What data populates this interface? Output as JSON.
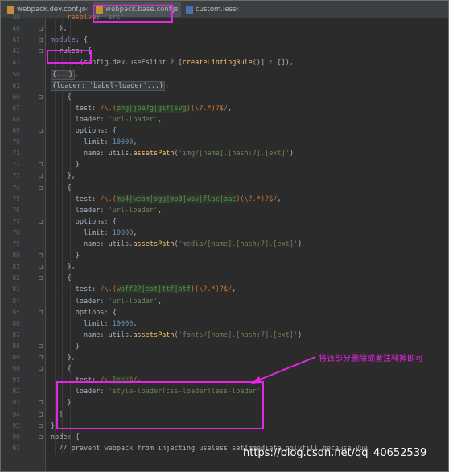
{
  "tabs": [
    {
      "label": "webpack.dev.conf.js",
      "close": "×",
      "icon": "js-file-icon",
      "active": false
    },
    {
      "label": "webpack.base.conf.js",
      "close": "×",
      "icon": "js-file-icon",
      "active": true
    },
    {
      "label": "custom.less",
      "close": "×",
      "icon": "less-file-icon",
      "active": false
    }
  ],
  "lines": [
    {
      "n": "39",
      "segs": [
        [
          "",
          "    "
        ],
        [
          "k",
          "resolve"
        ],
        [
          "",
          ": "
        ],
        [
          "s",
          "'src'"
        ],
        [
          "",
          ""
        ]
      ],
      "partial": true
    },
    {
      "n": "40",
      "segs": [
        [
          "",
          "  },"
        ]
      ]
    },
    {
      "n": "41",
      "segs": [
        [
          "p",
          "module"
        ],
        [
          "",
          ": {"
        ]
      ]
    },
    {
      "n": "42",
      "segs": [
        [
          "",
          "  rules: ["
        ]
      ]
    },
    {
      "n": "43",
      "segs": [
        [
          "",
          "    ..."
        ],
        [
          "",
          "(config.dev."
        ],
        [
          "",
          "useEslint"
        ],
        [
          "",
          " ? ["
        ],
        [
          "f",
          "createLintingRule"
        ],
        [
          "",
          "()] : []),"
        ]
      ]
    },
    {
      "n": "50",
      "segs": [
        [
          "fd",
          "{...}"
        ],
        [
          "",
          ","
        ]
      ]
    },
    {
      "n": "61",
      "segs": [
        [
          "fd",
          "{loader: 'babel-loader'...}"
        ],
        [
          "",
          ","
        ]
      ]
    },
    {
      "n": "66",
      "segs": [
        [
          "",
          "    {"
        ]
      ]
    },
    {
      "n": "67",
      "segs": [
        [
          "",
          "      test: "
        ],
        [
          "rxm",
          "/\\.("
        ],
        [
          "rx",
          "png|jpe?g|gif|svg"
        ],
        [
          "rxm",
          ")(\\?.*)?$/"
        ],
        [
          "",
          ","
        ]
      ]
    },
    {
      "n": "68",
      "segs": [
        [
          "",
          "      loader: "
        ],
        [
          "s",
          "'url-loader'"
        ],
        [
          "",
          ","
        ]
      ]
    },
    {
      "n": "69",
      "segs": [
        [
          "",
          "      options: {"
        ]
      ]
    },
    {
      "n": "70",
      "segs": [
        [
          "",
          "        limit: "
        ],
        [
          "n",
          "10000"
        ],
        [
          "",
          ","
        ]
      ]
    },
    {
      "n": "71",
      "segs": [
        [
          "",
          "        name: utils."
        ],
        [
          "f",
          "assetsPath"
        ],
        [
          "",
          "("
        ],
        [
          "s",
          "'img/[name].[hash:7].[ext]'"
        ],
        [
          "",
          ")"
        ]
      ]
    },
    {
      "n": "72",
      "segs": [
        [
          "",
          "      }"
        ]
      ]
    },
    {
      "n": "73",
      "segs": [
        [
          "",
          "    },"
        ]
      ]
    },
    {
      "n": "74",
      "segs": [
        [
          "",
          "    {"
        ]
      ]
    },
    {
      "n": "75",
      "segs": [
        [
          "",
          "      test: "
        ],
        [
          "rxm",
          "/\\.("
        ],
        [
          "rx",
          "mp4|webm|ogg|mp3|wav|flac|aac"
        ],
        [
          "rxm",
          ")(\\?.*)?$/"
        ],
        [
          "",
          ","
        ]
      ]
    },
    {
      "n": "76",
      "segs": [
        [
          "",
          "      loader: "
        ],
        [
          "s",
          "'url-loader'"
        ],
        [
          "",
          ","
        ]
      ]
    },
    {
      "n": "77",
      "segs": [
        [
          "",
          "      options: {"
        ]
      ]
    },
    {
      "n": "78",
      "segs": [
        [
          "",
          "        limit: "
        ],
        [
          "n",
          "10000"
        ],
        [
          "",
          ","
        ]
      ]
    },
    {
      "n": "79",
      "segs": [
        [
          "",
          "        name: utils."
        ],
        [
          "f",
          "assetsPath"
        ],
        [
          "",
          "("
        ],
        [
          "s",
          "'media/[name].[hash:7].[ext]'"
        ],
        [
          "",
          ")"
        ]
      ]
    },
    {
      "n": "80",
      "segs": [
        [
          "",
          "      }"
        ]
      ]
    },
    {
      "n": "81",
      "segs": [
        [
          "",
          "    },"
        ]
      ]
    },
    {
      "n": "82",
      "segs": [
        [
          "",
          "    {"
        ]
      ]
    },
    {
      "n": "83",
      "segs": [
        [
          "",
          "      test: "
        ],
        [
          "rxm",
          "/\\.("
        ],
        [
          "rx",
          "woff2?|eot|ttf|otf"
        ],
        [
          "rxm",
          ")(\\?.*)?$/"
        ],
        [
          "",
          ","
        ]
      ]
    },
    {
      "n": "84",
      "segs": [
        [
          "",
          "      loader: "
        ],
        [
          "s",
          "'url-loader'"
        ],
        [
          "",
          ","
        ]
      ]
    },
    {
      "n": "85",
      "segs": [
        [
          "",
          "      options: {"
        ]
      ]
    },
    {
      "n": "86",
      "segs": [
        [
          "",
          "        limit: "
        ],
        [
          "n",
          "10000"
        ],
        [
          "",
          ","
        ]
      ]
    },
    {
      "n": "87",
      "segs": [
        [
          "",
          "        name: utils."
        ],
        [
          "f",
          "assetsPath"
        ],
        [
          "",
          "("
        ],
        [
          "s",
          "'fonts/[name].[hash:7].[ext]'"
        ],
        [
          "",
          ")"
        ]
      ]
    },
    {
      "n": "88",
      "segs": [
        [
          "",
          "      }"
        ]
      ]
    },
    {
      "n": "89",
      "segs": [
        [
          "",
          "    },"
        ]
      ]
    },
    {
      "n": "90",
      "segs": [
        [
          "",
          "    {"
        ]
      ]
    },
    {
      "n": "91",
      "segs": [
        [
          "",
          "      test: "
        ],
        [
          "rxm",
          "/\\."
        ],
        [
          "rx",
          "less"
        ],
        [
          "rxm",
          "$/"
        ],
        [
          "",
          ","
        ]
      ]
    },
    {
      "n": "92",
      "segs": [
        [
          "",
          "      loader: "
        ],
        [
          "s",
          "'style-loader!css-loader!less-loader'"
        ]
      ]
    },
    {
      "n": "93",
      "segs": [
        [
          "",
          "    }"
        ]
      ]
    },
    {
      "n": "94",
      "segs": [
        [
          "",
          "  ]"
        ]
      ]
    },
    {
      "n": "95",
      "segs": [
        [
          "",
          "},"
        ]
      ]
    },
    {
      "n": "96",
      "segs": [
        [
          "",
          "node: {"
        ]
      ]
    },
    {
      "n": "97",
      "segs": [
        [
          "",
          "  // prevent webpack from injecting useless setImmediate polyfill because Vue"
        ]
      ],
      "partial": true
    }
  ],
  "annotation": "将该部分删除或者注释掉即可",
  "watermark": "https://blog.csdn.net/qq_40652539",
  "highlight_color": "#e426e4"
}
